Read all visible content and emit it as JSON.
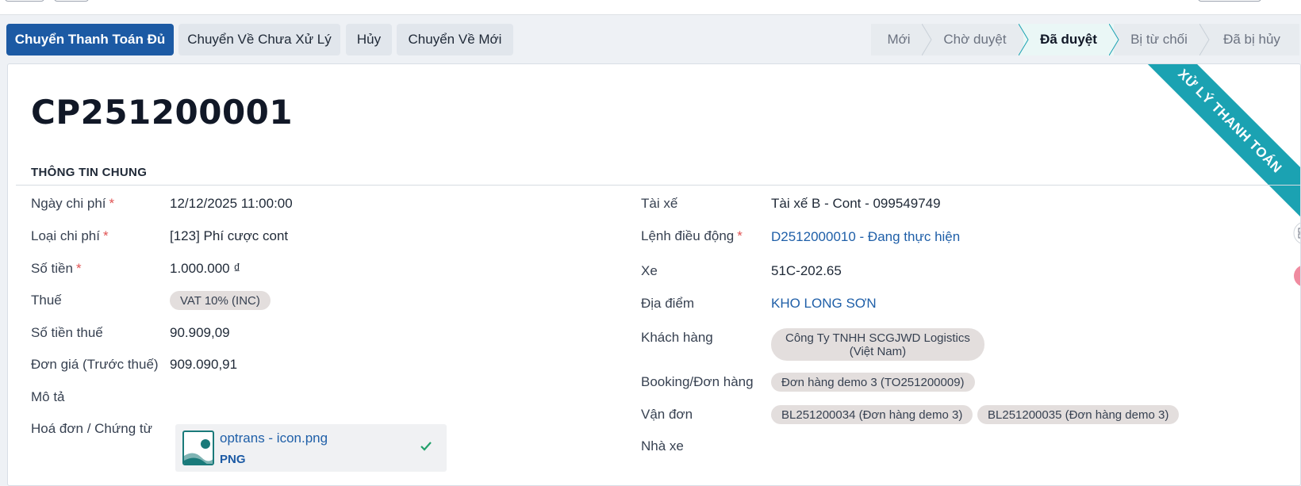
{
  "actions": {
    "pay_full": "Chuyển Thanh Toán Đủ",
    "to_unprocessed": "Chuyển Về Chưa Xử Lý",
    "cancel": "Hủy",
    "to_new": "Chuyển Về Mới"
  },
  "statusbar": {
    "stages": [
      "Mới",
      "Chờ duyệt",
      "Đã duyệt",
      "Bị từ chối",
      "Đã bị hủy"
    ],
    "current": "Đã duyệt"
  },
  "ribbon": "Xử lý thanh toán",
  "record": {
    "title": "CP251200001"
  },
  "section": {
    "title": "THÔNG TIN CHUNG"
  },
  "left_fields": {
    "date_label": "Ngày chi phí",
    "date_value": "12/12/2025 11:00:00",
    "type_label": "Loại chi phí",
    "type_value": "[123] Phí cược cont",
    "amount_label": "Số tiền",
    "amount_value": "1.000.000 ₫",
    "tax_label": "Thuế",
    "tax_value": "VAT 10% (INC)",
    "tax_amount_label": "Số tiền thuế",
    "tax_amount_value": "90.909,09",
    "unit_price_label": "Đơn giá (Trước thuế)",
    "unit_price_value": "909.090,91",
    "desc_label": "Mô tả",
    "invoice_label": "Hoá đơn / Chứng từ"
  },
  "attachment": {
    "name": "optrans - icon.png",
    "type": "PNG"
  },
  "right_fields": {
    "driver_label": "Tài xế",
    "driver_value": "Tài xế B - Cont - 099549749",
    "dispatch_label": "Lệnh điều động",
    "dispatch_value": "D2512000010 - Đang thực hiện",
    "vehicle_label": "Xe",
    "vehicle_value": "51C-202.65",
    "location_label": "Địa điểm",
    "location_value": "KHO LONG SƠN",
    "customer_label": "Khách hàng",
    "customer_line1": "Công Ty TNHH SCGJWD Logistics",
    "customer_line2": "(Việt Nam)",
    "booking_label": "Booking/Đơn hàng",
    "booking_value": "Đơn hàng demo 3 (TO251200009)",
    "bl_label": "Vận đơn",
    "bl_values": [
      "BL251200034 (Đơn hàng demo 3)",
      "BL251200035 (Đơn hàng demo 3)"
    ],
    "carrier_label": "Nhà xe"
  },
  "required_mark": "*",
  "colors": {
    "primary": "#1c5aa4",
    "ribbon": "#1ba2b2",
    "current_stage": "#eaf7f6",
    "link": "#1f5fa8",
    "required": "#e05353"
  }
}
